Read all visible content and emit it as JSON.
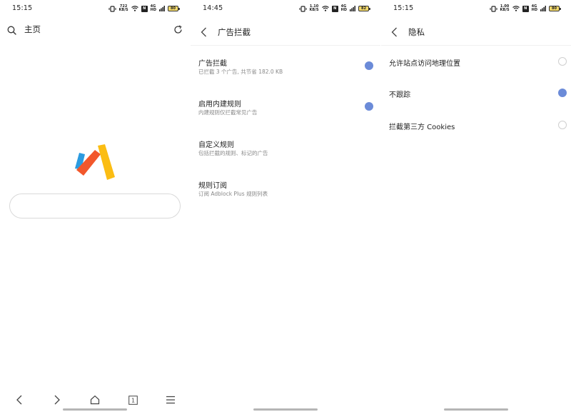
{
  "screens": [
    {
      "status": {
        "time": "15:15",
        "speed_top": "722",
        "speed_bottom": "KB/S",
        "battery": "80"
      },
      "header": {
        "title": "主页"
      },
      "icons": [
        "search-icon",
        "refresh-icon",
        "back-icon",
        "forward-icon",
        "home-icon",
        "tabs-icon",
        "menu-icon"
      ],
      "tab_count": "1"
    },
    {
      "status": {
        "time": "14:45",
        "speed_top": "1.10",
        "speed_bottom": "KB/S",
        "battery": "82"
      },
      "header": {
        "title": "广告拦截"
      },
      "items": [
        {
          "label": "广告拦截",
          "description": "已拦截 3 个广告, 共节省 182.0 KB",
          "enabled": true
        },
        {
          "label": "启用内建规则",
          "description": "内建规则仅拦截常见广告",
          "enabled": true
        },
        {
          "label": "自定义规则",
          "description": "包括拦截的规则、标记的广告"
        },
        {
          "label": "规则订阅",
          "description": "订阅 Adblock Plus 规则列表"
        }
      ]
    },
    {
      "status": {
        "time": "15:15",
        "speed_top": "1.00",
        "speed_bottom": "KB/S",
        "battery": "80"
      },
      "header": {
        "title": "隐私"
      },
      "items": [
        {
          "label": "允许站点访问地理位置",
          "enabled": false
        },
        {
          "label": "不跟踪",
          "enabled": true
        },
        {
          "label": "拦截第三方 Cookies",
          "enabled": false
        }
      ]
    }
  ],
  "colors": {
    "accent": "#6b8bd8",
    "logo_blue": "#2b9be0",
    "logo_red": "#f2572b",
    "logo_yellow": "#fbbd13"
  }
}
